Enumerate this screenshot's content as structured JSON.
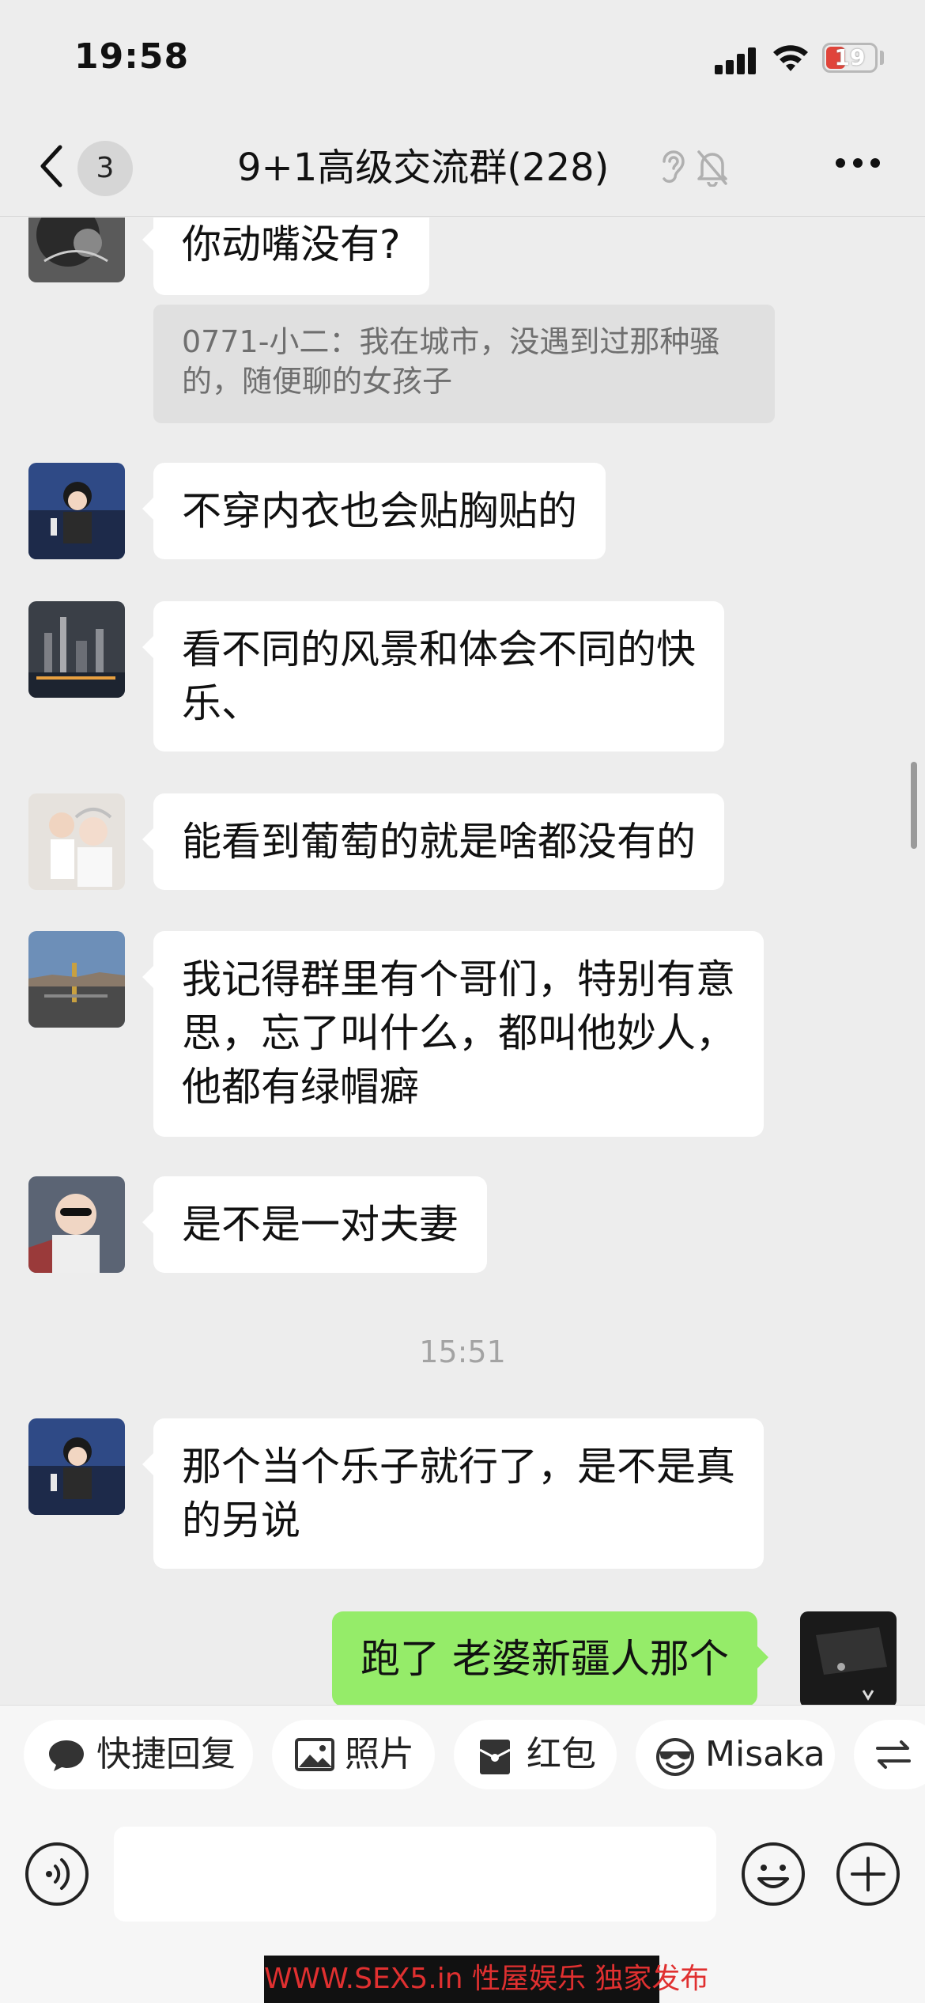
{
  "status": {
    "time": "19:58",
    "battery": "19"
  },
  "nav": {
    "back_count": "3",
    "title": "9+1高级交流群(228)"
  },
  "messages": [
    {
      "type": "incoming",
      "text": "你动嘴没有?"
    },
    {
      "type": "quote",
      "text": "0771-小二：我在城市，没遇到过那种骚的，随便聊的女孩子"
    },
    {
      "type": "incoming",
      "text": "不穿内衣也会贴胸贴的"
    },
    {
      "type": "incoming",
      "lines": [
        "看不同的风景和体会不同的快",
        "乐、"
      ]
    },
    {
      "type": "incoming",
      "text": "能看到葡萄的就是啥都没有的"
    },
    {
      "type": "incoming",
      "lines": [
        "我记得群里有个哥们，特别有意",
        "思，忘了叫什么，都叫他妙人，",
        "他都有绿帽癖"
      ]
    },
    {
      "type": "incoming",
      "text": "是不是一对夫妻"
    },
    {
      "type": "time",
      "text": "15:51"
    },
    {
      "type": "incoming",
      "lines": [
        "那个当个乐子就行了，是不是真",
        "的另说"
      ]
    },
    {
      "type": "outgoing",
      "text": "跑了 老婆新疆人那个"
    }
  ],
  "quick_reply": {
    "shortcut": "快捷回复",
    "photo": "照片",
    "red_packet": "红包",
    "misaka": "Misaka"
  },
  "input": {
    "placeholder": ""
  },
  "watermark": {
    "text": "WWW.SEX5.in 性屋娱乐 独家发布"
  },
  "colors": {
    "background": "#ededed",
    "incoming_bubble": "#ffffff",
    "outgoing_bubble": "#95ec69",
    "quote_bg": "#e0e0e0"
  }
}
